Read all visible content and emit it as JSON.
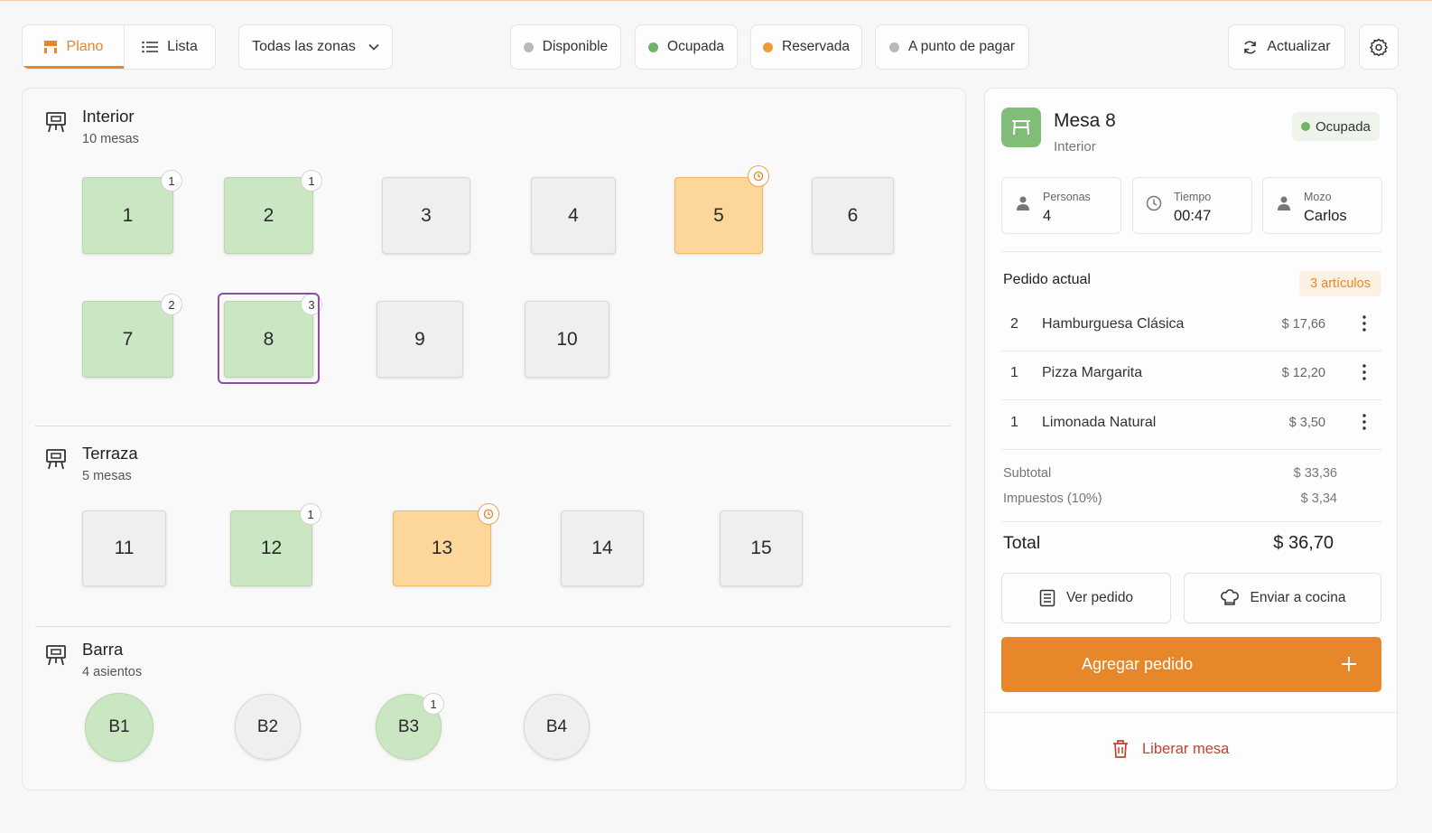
{
  "toolbar": {
    "plano_label": "Plano",
    "lista_label": "Lista",
    "zone_select": "Todas las zonas",
    "legend": [
      {
        "label": "Disponible",
        "color": "#b9b9b9"
      },
      {
        "label": "Ocupada",
        "color": "#6fb468"
      },
      {
        "label": "Reservada",
        "color": "#ef9b3c"
      },
      {
        "label": "A punto de pagar",
        "color": "#b9b9b9"
      }
    ],
    "refresh_label": "Actualizar"
  },
  "zones": {
    "interior": {
      "title": "Interior",
      "count": "10 mesas"
    },
    "terraza": {
      "title": "Terraza",
      "count": "5 mesas"
    },
    "barra": {
      "title": "Barra",
      "count": "4 asientos"
    }
  },
  "tables": {
    "t1": {
      "label": "1",
      "status": "ocupada",
      "badge": "1"
    },
    "t2": {
      "label": "2",
      "status": "ocupada",
      "badge": "1"
    },
    "t3": {
      "label": "3",
      "status": "disponible"
    },
    "t4": {
      "label": "4",
      "status": "disponible"
    },
    "t5": {
      "label": "5",
      "status": "reservada"
    },
    "t6": {
      "label": "6",
      "status": "disponible"
    },
    "t7": {
      "label": "7",
      "status": "ocupada",
      "badge": "2"
    },
    "t8": {
      "label": "8",
      "status": "ocupada",
      "badge": "3",
      "selected": true
    },
    "t9": {
      "label": "9",
      "status": "disponible"
    },
    "t10": {
      "label": "10",
      "status": "disponible"
    },
    "t11": {
      "label": "11",
      "status": "disponible"
    },
    "t12": {
      "label": "12",
      "status": "ocupada",
      "badge": "1"
    },
    "t13": {
      "label": "13",
      "status": "reservada"
    },
    "t14": {
      "label": "14",
      "status": "disponible"
    },
    "t15": {
      "label": "15",
      "status": "disponible"
    },
    "b1": {
      "label": "B1",
      "status": "ocupada"
    },
    "b2": {
      "label": "B2",
      "status": "disponible"
    },
    "b3": {
      "label": "B3",
      "status": "ocupada",
      "badge": "1"
    },
    "b4": {
      "label": "B4",
      "status": "disponible"
    }
  },
  "detail": {
    "title": "Mesa 8",
    "zone": "Interior",
    "status": "Ocupada",
    "status_color": "#6fb468",
    "info": {
      "personas": {
        "label": "Personas",
        "value": "4"
      },
      "tiempo": {
        "label": "Tiempo",
        "value": "00:47"
      },
      "mozo": {
        "label": "Mozo",
        "value": "Carlos"
      }
    },
    "order_title": "Pedido actual",
    "order_count": "3 artículos",
    "items": [
      {
        "qty": "2",
        "name": "Hamburguesa Clásica",
        "price": "$ 17,66"
      },
      {
        "qty": "1",
        "name": "Pizza Margarita",
        "price": "$ 12,20"
      },
      {
        "qty": "1",
        "name": "Limonada Natural",
        "price": "$ 3,50"
      }
    ],
    "subtotal": {
      "label": "Subtotal",
      "value": "$ 33,36"
    },
    "taxes": {
      "label": "Impuestos (10%)",
      "value": "$ 3,34"
    },
    "total": {
      "label": "Total",
      "value": "$ 36,70"
    },
    "view_order_label": "Ver pedido",
    "send_kitchen_label": "Enviar a cocina",
    "add_order_label": "Agregar pedido",
    "release_label": "Liberar mesa"
  },
  "colors": {
    "accent": "#e8872a",
    "occupied": "#cbe6c3",
    "reserved": "#fdd699",
    "free": "#efefef",
    "selected": "#8e4fa3",
    "danger": "#c8402f"
  }
}
